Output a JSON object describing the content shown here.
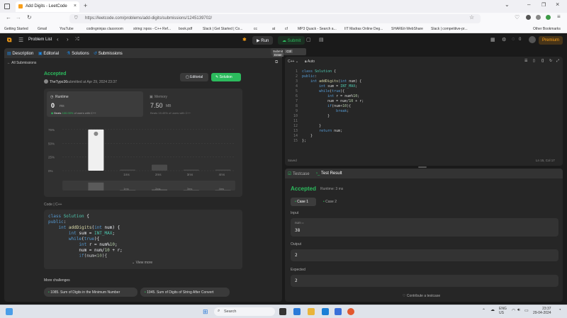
{
  "browser": {
    "tab_title": "Add Digits - LeetCode",
    "url": "https://leetcode.com/problems/add-digits/submissions/1245139702/",
    "bookmarks": [
      "Getting Started",
      "Gmail",
      "YouTube",
      "codingninjas classroom",
      "string::npos - C++ Ref...",
      "book.pdf",
      "Slack | Get Started | Co...",
      "cc",
      "at",
      "cf",
      "MP3 Quack - Search a...",
      "IIT Madras Online Deg...",
      "SHAREit-WebShare",
      "Slack | competitive-pr..."
    ],
    "other_bookmarks": "Other Bookmarks"
  },
  "nav": {
    "problem_list": "Problem List",
    "run": "Run",
    "submit": "Submit",
    "streak": "0",
    "premium": "Premium"
  },
  "left_tabs": [
    "Description",
    "Editorial",
    "Solutions",
    "Submissions"
  ],
  "all_submissions": "All Submissions",
  "result": {
    "status": "Accepted",
    "user": "TheTypo36",
    "submitted": "submitted at Apr 29, 2024 23:37",
    "editorial_btn": "Editorial",
    "solution_btn": "Solution"
  },
  "runtime": {
    "label": "Runtime",
    "value": "0",
    "unit": "ms",
    "beats_label": "Beats",
    "beats_value": "100.00%",
    "beats_suffix": "of users with C++"
  },
  "memory": {
    "label": "Memory",
    "value": "7.50",
    "unit": "MB",
    "beats_text": "Beats 15.45% of users with C++"
  },
  "chart_data": {
    "type": "bar",
    "categories": [
      "0ms",
      "1ms",
      "2ms",
      "3ms",
      "4ms"
    ],
    "values": [
      75,
      1,
      11,
      1,
      1
    ],
    "yticks": [
      "75%",
      "50%",
      "25%",
      "0%"
    ],
    "ylim": [
      0,
      80
    ],
    "grid": true,
    "highlight_index": 0
  },
  "code_section": {
    "label": "Code",
    "lang": "C++",
    "view_more": "View more"
  },
  "more_challenges": {
    "label": "More challenges",
    "items": [
      "1085. Sum of Digits in the Minimum Number",
      "1945. Sum of Digits of String After Convert"
    ]
  },
  "editor": {
    "lang": "C++",
    "mode": "Auto",
    "saved": "Saved",
    "cursor": "Ln 15, Col 17",
    "lines": [
      "class Solution {",
      "public:",
      "    int addDigits(int num) {",
      "        int sum = INT_MAX;",
      "        while(true){",
      "            int r = num%10;",
      "            num = num/10 + r;",
      "            if(num<10){",
      "                break;",
      "            }",
      "",
      "        }",
      "        return num;",
      "    }",
      "};"
    ]
  },
  "short_code": [
    "class Solution {",
    "public:",
    "    int addDigits(int num) {",
    "        int sum = INT_MAX;",
    "        while(true){",
    "            int r = num%10;",
    "            num = num/10 + r;",
    "            if(num<10){"
  ],
  "tooltip": {
    "submit": "Submit",
    "k1": "Ctrl",
    "k2": "Enter"
  },
  "testpanel": {
    "tab1": "Testcase",
    "tab2": "Test Result",
    "status": "Accepted",
    "runtime": "Runtime: 3 ms",
    "case1": "Case 1",
    "case2": "Case 2",
    "input_label": "Input",
    "var_name": "num =",
    "input_value": "38",
    "output_label": "Output",
    "output_value": "2",
    "expected_label": "Expected",
    "expected_value": "2",
    "contribute": "Contribute a testcase"
  },
  "taskbar": {
    "search": "Search",
    "lang": "ENG",
    "region": "US",
    "time": "23:37",
    "date": "29-04-2024"
  }
}
